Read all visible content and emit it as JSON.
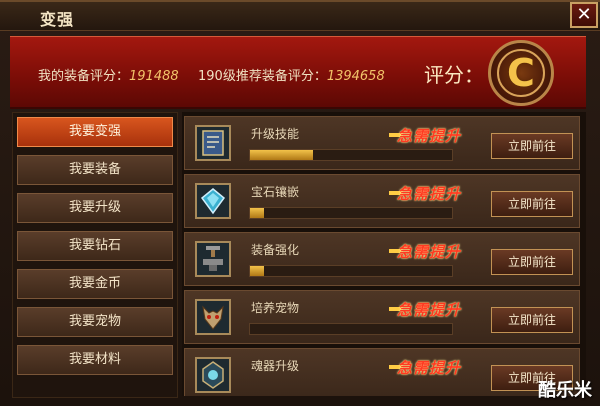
{
  "window": {
    "title": "变强",
    "close_icon": "close-icon"
  },
  "banner": {
    "my_score_label": "我的装备评分：",
    "my_score_value": "191488",
    "recommend_label": "190级推荐装备评分：",
    "recommend_value": "1394658",
    "score_label": "评分：",
    "rank": "C"
  },
  "sidebar": {
    "items": [
      {
        "label": "我要变强",
        "active": true
      },
      {
        "label": "我要装备",
        "active": false
      },
      {
        "label": "我要升级",
        "active": false
      },
      {
        "label": "我要钻石",
        "active": false
      },
      {
        "label": "我要金币",
        "active": false
      },
      {
        "label": "我要宠物",
        "active": false
      },
      {
        "label": "我要材料",
        "active": false
      }
    ]
  },
  "rows": [
    {
      "name": "升级技能",
      "tag": "急需提升",
      "button": "立即前往",
      "progress": 0.31,
      "icon": "skill-book-icon"
    },
    {
      "name": "宝石镶嵌",
      "tag": "急需提升",
      "button": "立即前往",
      "progress": 0.07,
      "icon": "gem-icon"
    },
    {
      "name": "装备强化",
      "tag": "急需提升",
      "button": "立即前往",
      "progress": 0.07,
      "icon": "anvil-icon"
    },
    {
      "name": "培养宠物",
      "tag": "急需提升",
      "button": "立即前往",
      "progress": 0.0,
      "icon": "pet-icon"
    },
    {
      "name": "魂器升级",
      "tag": "急需提升",
      "button": "立即前往",
      "progress": 0.0,
      "icon": "soul-artifact-icon"
    }
  ],
  "watermark": "酷乐米",
  "colors": {
    "accent": "#d8561e",
    "banner": "#a3180f",
    "tag": "#ff3a22",
    "progress": "#f2c24a"
  }
}
